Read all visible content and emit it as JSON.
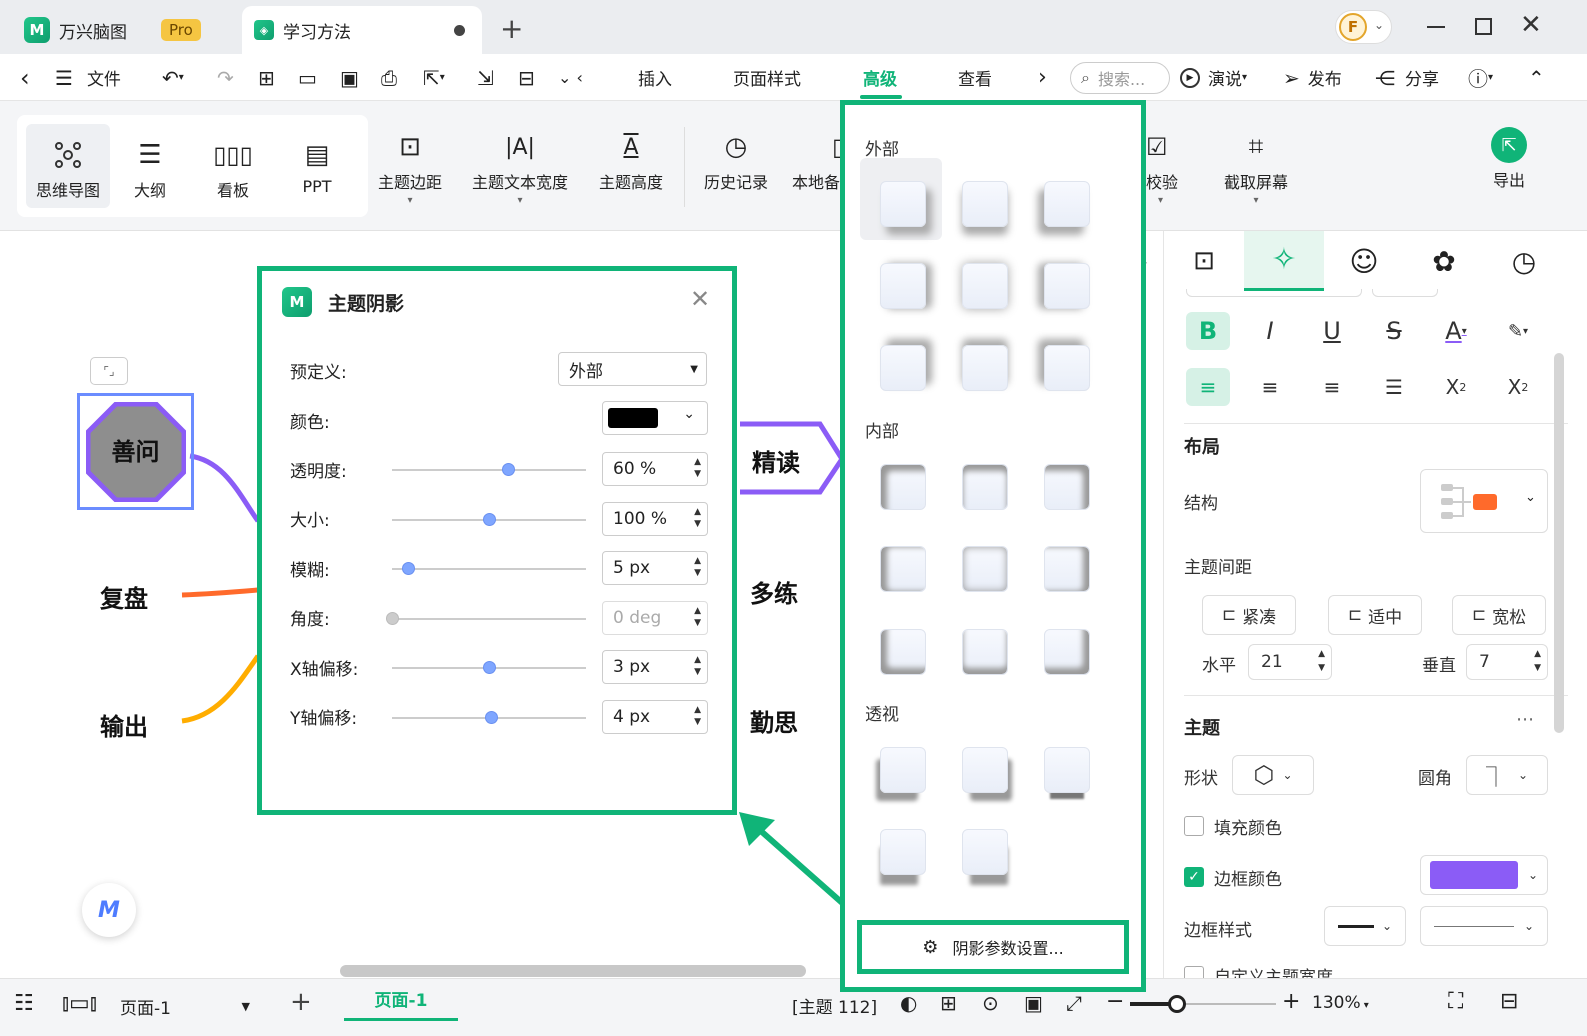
{
  "titlebar": {
    "app_tab": {
      "label": "万兴脑图",
      "badge": "Pro"
    },
    "doc_tab": {
      "label": "学习方法"
    },
    "avatar_letter": "F"
  },
  "menubar": {
    "file": "文件",
    "tabs": [
      "插入",
      "页面样式",
      "高级",
      "查看"
    ],
    "active_tab": "高级",
    "search_placeholder": "搜索...",
    "present": "演说",
    "publish": "发布",
    "share": "分享"
  },
  "ribbon": {
    "views": [
      "思维导图",
      "大纲",
      "看板",
      "PPT"
    ],
    "tools": [
      "主题边距",
      "主题文本宽度",
      "主题高度",
      "历史记录",
      "本地备",
      "校验",
      "截取屏幕"
    ],
    "export": "导出"
  },
  "canvas": {
    "center_node": "善问",
    "left_nodes": [
      "复盘",
      "输出"
    ],
    "right_nodes": [
      "精读",
      "多练",
      "勤思"
    ]
  },
  "dialog": {
    "title": "主题阴影",
    "preset_label": "预定义:",
    "preset_value": "外部",
    "color_label": "颜色:",
    "color_value": "#000000",
    "rows": [
      {
        "label": "透明度:",
        "value": "60 %",
        "level": 0.6
      },
      {
        "label": "大小:",
        "value": "100 %",
        "level": 0.5
      },
      {
        "label": "模糊:",
        "value": "5 px",
        "level": 0.08
      },
      {
        "label": "角度:",
        "value": "0 deg",
        "level": 0.0,
        "disabled": true
      },
      {
        "label": "X轴偏移:",
        "value": "3 px",
        "level": 0.5
      },
      {
        "label": "Y轴偏移:",
        "value": "4 px",
        "level": 0.51
      }
    ]
  },
  "gallery": {
    "sections": [
      "外部",
      "内部",
      "透视"
    ],
    "settings_button": "阴影参数设置..."
  },
  "rpanel": {
    "layout_title": "布局",
    "structure_label": "结构",
    "spacing_label": "主题间距",
    "spacing_options": [
      "紧凑",
      "适中",
      "宽松"
    ],
    "horizontal_label": "水平",
    "horizontal_value": "21",
    "vertical_label": "垂直",
    "vertical_value": "7",
    "topic_title": "主题",
    "shape_label": "形状",
    "corner_label": "圆角",
    "fill_label": "填充颜色",
    "border_color_label": "边框颜色",
    "border_color": "#8b5cf6",
    "border_style_label": "边框样式",
    "custom_width_label": "自定义主题宽度"
  },
  "statusbar": {
    "page_select": "页面-1",
    "page_tab": "页面-1",
    "topic_count": "[主题 112]",
    "zoom": "130%"
  },
  "colors": {
    "accent": "#10b478",
    "node_border": "#8b5cf6",
    "branch_purple": "#8b5cf6",
    "branch_orange": "#ff6a2b",
    "branch_yellow": "#ffad00"
  }
}
